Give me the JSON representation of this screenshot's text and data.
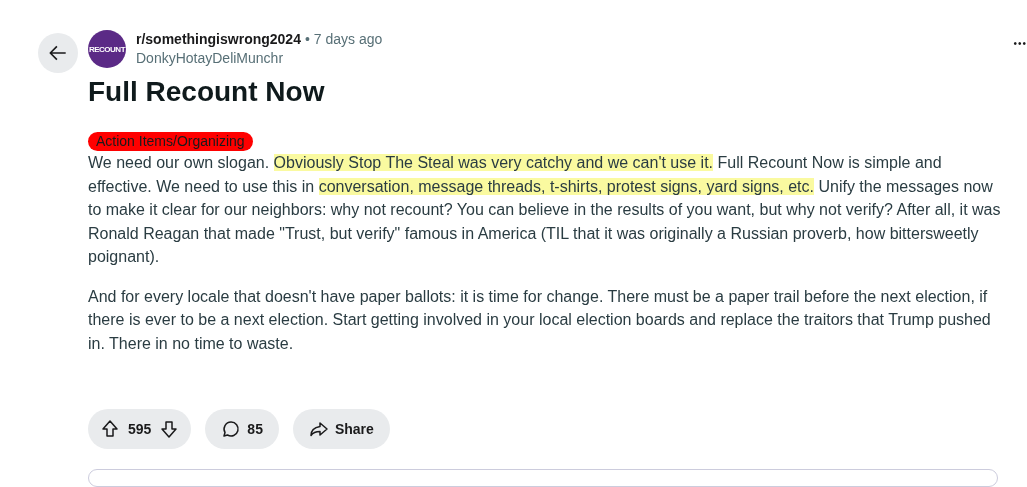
{
  "post": {
    "avatar_text": "RECOUNT",
    "subreddit": "r/somethingiswrong2024",
    "separator": "•",
    "time": "7 days ago",
    "author": "DonkyHotayDeliMunchr",
    "more": "•••",
    "title": "Full Recount Now",
    "flair": {
      "label": "Action Items/Organizing",
      "color": "#ff0000"
    },
    "paragraphs": [
      [
        {
          "text": "We need our own slogan. ",
          "highlighted": false
        },
        {
          "text": "Obviously Stop The Steal was very catchy and we can't use it.",
          "highlighted": true
        },
        {
          "text": " Full Recount Now is simple and effective. We need to use this in ",
          "highlighted": false
        },
        {
          "text": "conversation, message threads, t-shirts, protest signs, yard signs, etc.",
          "highlighted": true
        },
        {
          "text": " Unify the messages now to make it clear for our neighbors: why not recount? You can believe in the results of you want, but why not verify? After all, it was Ronald Reagan that made \"Trust, but verify\" famous in America (TIL that it was originally a Russian proverb, how bittersweetly poignant).",
          "highlighted": false
        }
      ],
      [
        {
          "text": "And for every locale that doesn't have paper ballots: it is time for change. There must be a paper trail before the next election, if there is ever to be a next election. Start getting involved in your local election boards and replace the traitors that Trump pushed in. There in no time to waste.",
          "highlighted": false
        }
      ]
    ],
    "votes": "595",
    "comments": "85",
    "share": "Share"
  }
}
